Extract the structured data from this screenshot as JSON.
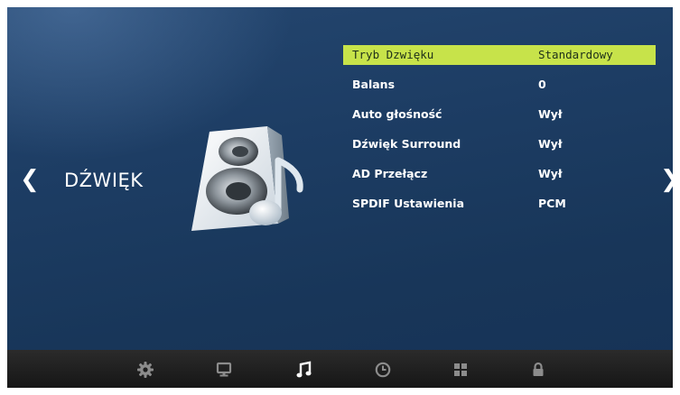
{
  "section": {
    "title": "DŹWIĘK",
    "prev_icon": "chevron-left-icon",
    "next_icon": "chevron-right-icon",
    "icon": "speaker-music-icon"
  },
  "menu": {
    "selected_color": "#c7e34a",
    "items": [
      {
        "label": "Tryb Dzwięku",
        "value": "Standardowy",
        "selected": true
      },
      {
        "label": "Balans",
        "value": "0"
      },
      {
        "label": "Auto głośność",
        "value": "Wył"
      },
      {
        "label": "Dźwięk Surround",
        "value": "Wył"
      },
      {
        "label": "AD Przełącz",
        "value": "Wył"
      },
      {
        "label": "SPDIF Ustawienia",
        "value": "PCM"
      }
    ]
  },
  "bottom_nav": {
    "active": "music-icon",
    "icons": [
      "gear-icon",
      "monitor-icon",
      "music-icon",
      "clock-icon",
      "grid-icon",
      "lock-icon"
    ]
  }
}
